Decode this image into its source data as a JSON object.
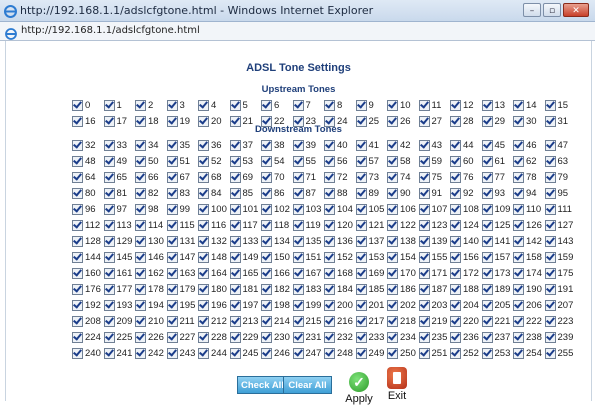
{
  "window": {
    "title": "http://192.168.1.1/adslcfgtone.html - Windows Internet Explorer",
    "url": "http://192.168.1.1/adslcfgtone.html",
    "buttons": {
      "minimize": "–",
      "maximize": "▫",
      "close": "✕"
    }
  },
  "page": {
    "title": "ADSL Tone Settings",
    "upstream_heading": "Upstream Tones",
    "downstream_heading": "Downstream Tones"
  },
  "upstream": {
    "start": 0,
    "end": 31,
    "checked": true
  },
  "downstream": {
    "start": 32,
    "end": 255,
    "checked": true
  },
  "buttons": {
    "check_all": "Check All",
    "clear_all": "Clear All",
    "apply": "Apply",
    "exit": "Exit"
  },
  "icons": {
    "browser": "ie-logo-icon",
    "page": "ie-page-icon",
    "apply": "green-check-icon",
    "exit": "red-exit-door-icon"
  },
  "colors": {
    "heading": "#1f3f7a",
    "button": "#3f9fd6",
    "apply": "#2c9a29",
    "exit": "#b4301a"
  }
}
